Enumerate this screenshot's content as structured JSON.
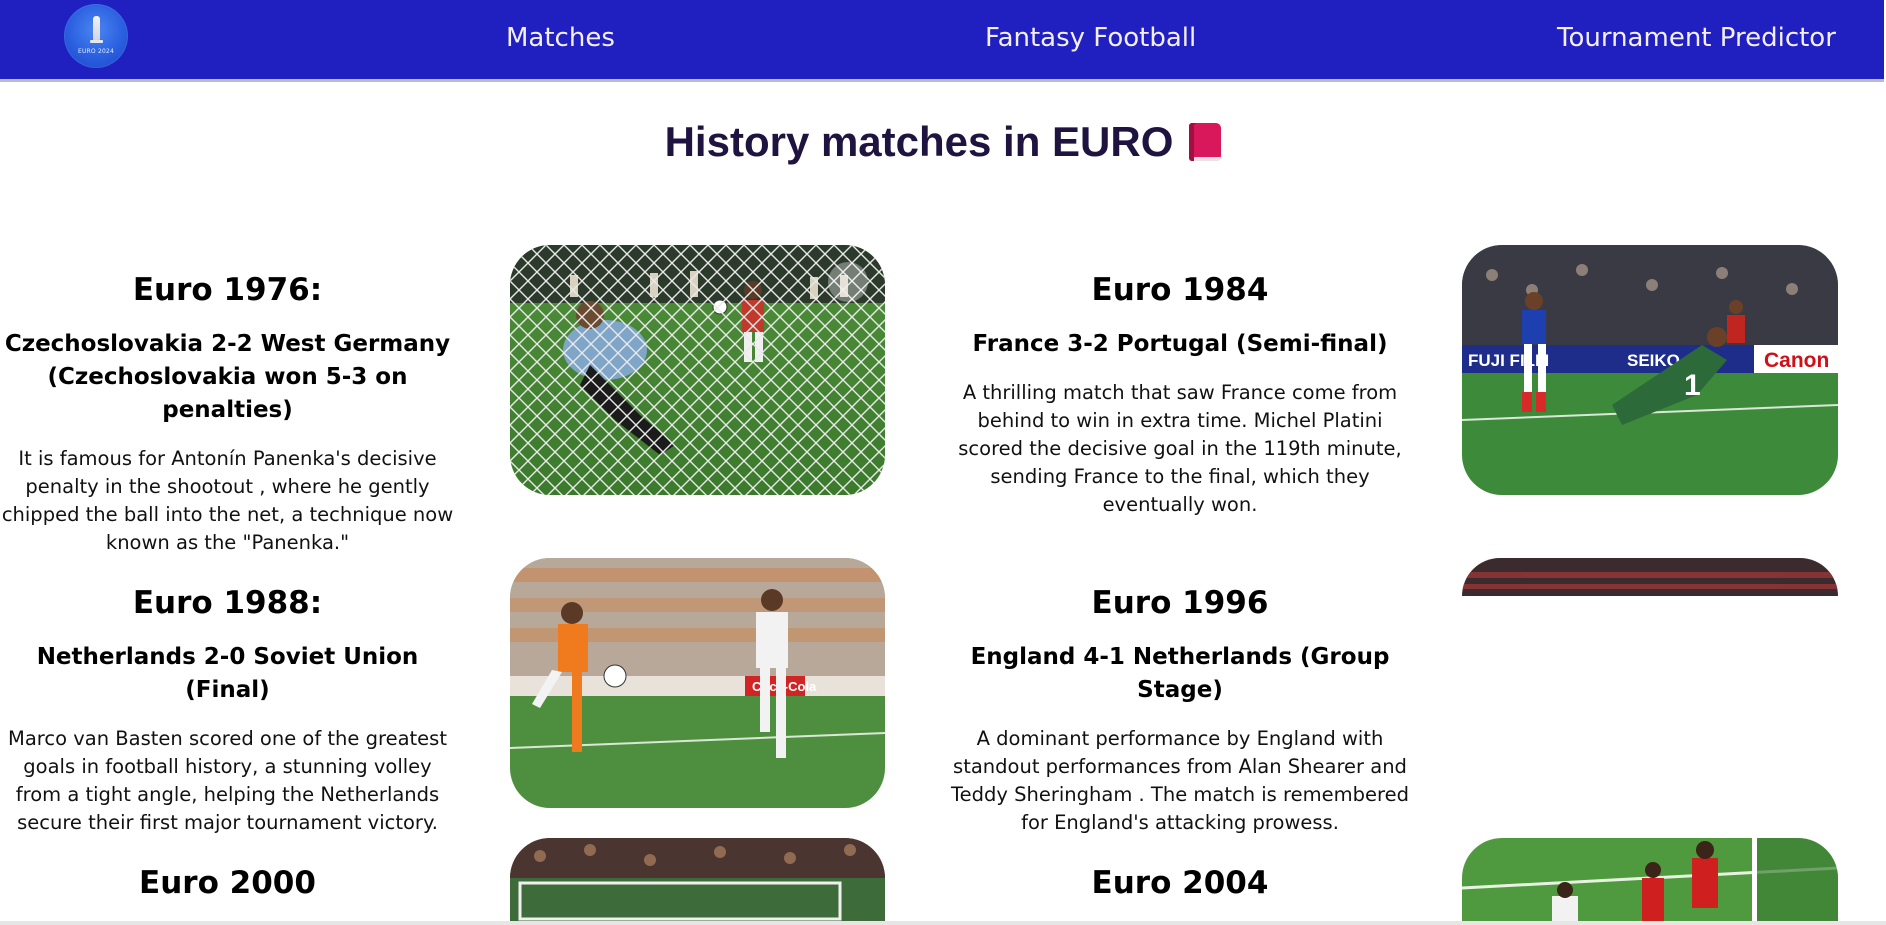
{
  "nav": {
    "logo_text": "EURO 2024",
    "links": [
      "Matches",
      "Fantasy Football",
      "Tournament Predictor"
    ]
  },
  "page_title": "History matches in EURO",
  "matches": [
    {
      "year": "Euro 1976:",
      "title": "Czechoslovakia 2-2 West Germany (Czechoslovakia won 5-3 on penalties)",
      "description": "It is famous for Antonín Panenka's decisive penalty in the shootout , where he gently chipped the ball into the net, a technique now known as the \"Panenka.\""
    },
    {
      "year": "Euro 1984",
      "title": "France 3-2 Portugal (Semi-final)",
      "description": "A thrilling match that saw France come from behind to win in extra time. Michel Platini scored the decisive goal in the 119th minute, sending France to the final, which they eventually won."
    },
    {
      "year": "Euro 1988:",
      "title": "Netherlands 2-0 Soviet Union (Final)",
      "description": "Marco van Basten scored one of the greatest goals in football history, a stunning volley from a tight angle, helping the Netherlands secure their first major tournament victory."
    },
    {
      "year": "Euro 1996",
      "title": "England 4-1 Netherlands (Group Stage)",
      "description": "A dominant performance by England with standout performances from Alan Shearer and Teddy Sheringham . The match is remembered for England's attacking prowess."
    },
    {
      "year": "Euro 2000"
    },
    {
      "year": "Euro 2004"
    }
  ],
  "photo_texts": {
    "board_fuji": "FUJI FILM",
    "board_canon": "Canon",
    "board_seiko": "SEIKO",
    "board_coca": "Coca-Cola",
    "keeper_number": "1"
  }
}
